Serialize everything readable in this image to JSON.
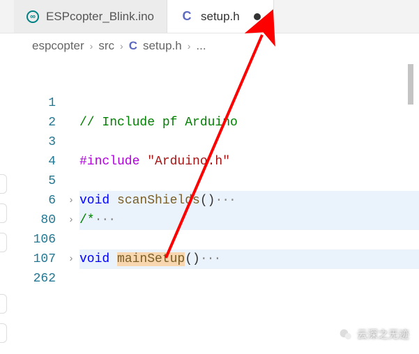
{
  "tabs": [
    {
      "icon": "∞",
      "label": "ESPcopter_Blink.ino",
      "active": false,
      "dirty": false
    },
    {
      "icon": "C",
      "label": "setup.h",
      "active": true,
      "dirty": true
    }
  ],
  "breadcrumb": {
    "parts": [
      "espcopter",
      "src",
      "setup.h",
      "..."
    ],
    "file_icon": "C"
  },
  "code": {
    "lines": [
      {
        "n": "1",
        "fold": "",
        "hl": false,
        "tokens": []
      },
      {
        "n": "2",
        "fold": "",
        "hl": false,
        "tokens": [
          {
            "t": "// Include pf Arduino",
            "c": "c-comment"
          }
        ]
      },
      {
        "n": "3",
        "fold": "",
        "hl": false,
        "tokens": []
      },
      {
        "n": "4",
        "fold": "",
        "hl": false,
        "tokens": [
          {
            "t": "#include ",
            "c": "c-keyword"
          },
          {
            "t": "\"Arduino.h\"",
            "c": "c-string"
          }
        ]
      },
      {
        "n": "5",
        "fold": "",
        "hl": false,
        "tokens": []
      },
      {
        "n": "6",
        "fold": "›",
        "hl": true,
        "tokens": [
          {
            "t": "void ",
            "c": "c-type"
          },
          {
            "t": "scanShields",
            "c": "c-func"
          },
          {
            "t": "()",
            "c": "c-punct"
          },
          {
            "t": "···",
            "c": "c-ellipsis"
          }
        ]
      },
      {
        "n": "80",
        "fold": "›",
        "hl": true,
        "tokens": [
          {
            "t": "/*",
            "c": "c-comment"
          },
          {
            "t": "···",
            "c": "c-ellipsis"
          }
        ]
      },
      {
        "n": "106",
        "fold": "",
        "hl": false,
        "tokens": []
      },
      {
        "n": "107",
        "fold": "›",
        "hl": true,
        "tokens": [
          {
            "t": "void ",
            "c": "c-type"
          },
          {
            "t": "mainSetup",
            "c": "c-func",
            "sel": true
          },
          {
            "t": "()",
            "c": "c-punct"
          },
          {
            "t": "···",
            "c": "c-ellipsis"
          }
        ]
      },
      {
        "n": "262",
        "fold": "",
        "hl": false,
        "tokens": []
      }
    ]
  },
  "watermark": "云深之无迹"
}
